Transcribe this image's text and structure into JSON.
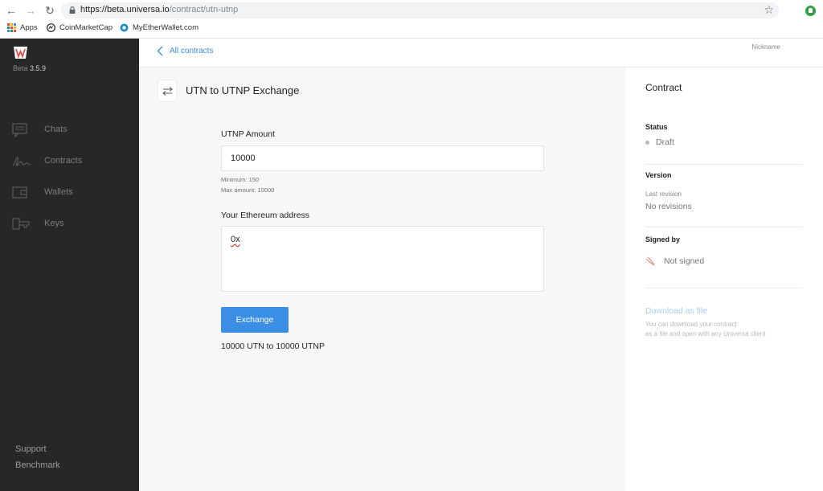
{
  "browser": {
    "url_host": "https://beta.universa.io",
    "url_path": "/contract/utn-utnp",
    "bookmarks": [
      "Apps",
      "CoinMarketCap",
      "MyEtherWallet.com"
    ]
  },
  "sidebar": {
    "version_prefix": "Beta",
    "version_number": "3.5.9",
    "items": [
      {
        "label": "Chats",
        "icon": "chat-icon"
      },
      {
        "label": "Contracts",
        "icon": "signature-icon"
      },
      {
        "label": "Wallets",
        "icon": "wallet-icon"
      },
      {
        "label": "Keys",
        "icon": "key-icon"
      }
    ],
    "footer_links": [
      "Support",
      "Benchmark"
    ]
  },
  "topbar": {
    "back_label": "All contracts",
    "nickname": "Nickname"
  },
  "main": {
    "title": "UTN to UTNP Exchange",
    "amount_label": "UTNP Amount",
    "amount_value": "10000",
    "min_hint": "Minimum: 150",
    "max_hint": "Max amount: 10000",
    "address_label": "Your Ethereum address",
    "address_value": "0x",
    "exchange_button": "Exchange",
    "result_text": "10000 UTN to 10000 UTNP"
  },
  "panel": {
    "title": "Contract",
    "status_label": "Status",
    "status_value": "Draft",
    "version_label": "Version",
    "last_revision_label": "Last revision",
    "last_revision_value": "No revisions",
    "signed_by_label": "Signed by",
    "signed_value": "Not signed",
    "download_link": "Download as file",
    "download_note_1": "You can download your contract",
    "download_note_2": "as a file and open with any Universa client"
  },
  "colors": {
    "accent": "#3a8ee6",
    "sidebar_bg": "#272727",
    "content_bg": "#f7f7f7"
  }
}
